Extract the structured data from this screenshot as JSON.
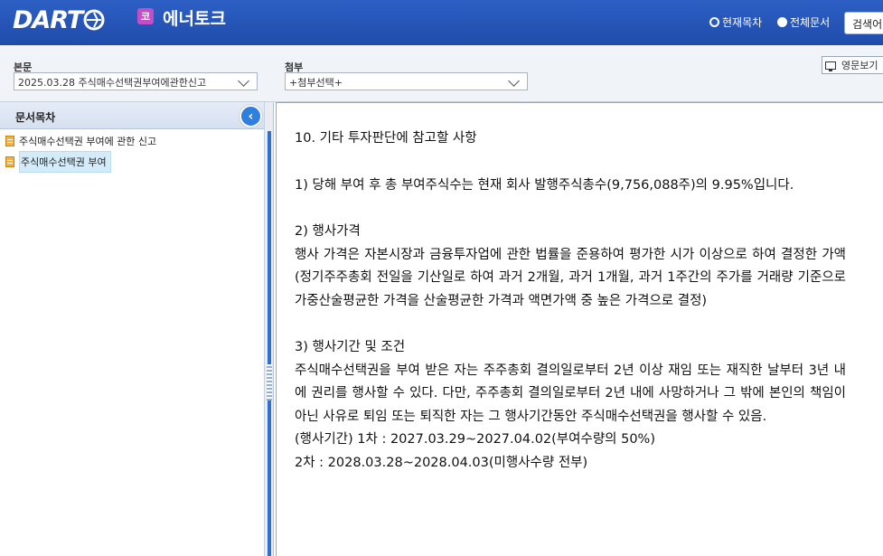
{
  "header": {
    "logo_text": "DART",
    "company_badge": "코",
    "company_name": "에너토크",
    "radio_toc": "현재목차",
    "radio_all": "전체문서",
    "search_label": "검색어"
  },
  "toolbar": {
    "body_label": "본문",
    "body_select": "2025.03.28  주식매수선택권부여에관한신고",
    "attach_label": "첨부",
    "attach_select": "+첨부선택+",
    "english_label": "영문보기"
  },
  "sidebar": {
    "title": "문서목차",
    "items": [
      {
        "label": "주식매수선택권 부여에 관한 신고"
      },
      {
        "label": "주식매수선택권 부여"
      }
    ]
  },
  "document": {
    "heading": "10. 기타 투자판단에 참고할 사항",
    "item1": "1) 당해 부여 후 총 부여주식수는 현재 회사 발행주식총수(9,756,088주)의 9.95%입니다.",
    "item2_title": "2) 행사가격",
    "item2_body": "행사 가격은 자본시장과 금융투자업에 관한 법률을 준용하여 평가한 시가 이상으로 하여 결정한 가액 (정기주주총회 전일을 기산일로 하여 과거 2개월, 과거 1개월, 과거 1주간의 주가를 거래량 기준으로 가중산술평균한 가격을 산술평균한 가격과 액면가액 중 높은 가격으로 결정)",
    "item3_title": "3) 행사기간 및 조건",
    "item3_body": "주식매수선택권을 부여 받은 자는 주주총회 결의일로부터 2년 이상 재임 또는 재직한 날부터 3년 내에 권리를 행사할 수 있다. 다만, 주주총회 결의일로부터 2년 내에 사망하거나 그 밖에 본인의 책임이 아닌 사유로 퇴임 또는 퇴직한 자는 그 행사기간동안 주식매수선택권을 행사할 수 있음.",
    "period1": "(행사기간)  1차 : 2027.03.29~2027.04.02(부여수량의 50%)",
    "period2": "            2차 : 2028.03.28~2028.04.03(미행사수량 전부)"
  }
}
